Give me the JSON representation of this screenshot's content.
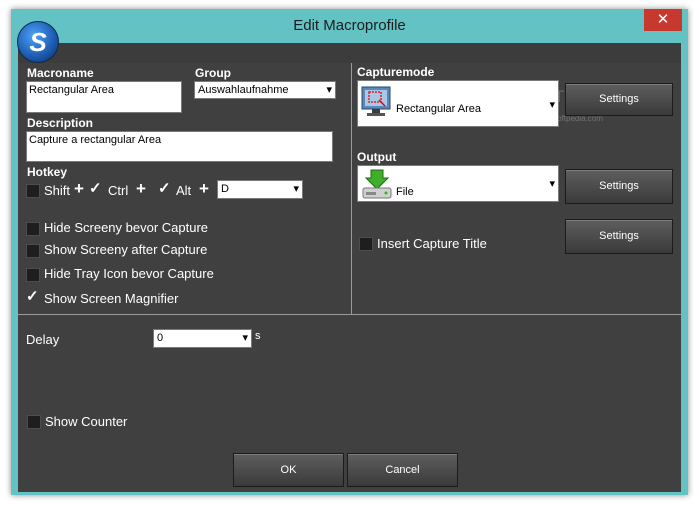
{
  "window": {
    "title": "Edit Macroprofile",
    "close_glyph": "✕",
    "logo_letter": "S"
  },
  "macro": {
    "macroname_label": "Macroname",
    "macroname_value": "Rectangular Area",
    "group_label": "Group",
    "group_value": "Auswahlaufnahme",
    "description_label": "Description",
    "description_value": "Capture a rectangular Area"
  },
  "hotkey": {
    "label": "Hotkey",
    "shift_label": "Shift",
    "shift_checked": false,
    "ctrl_label": "Ctrl",
    "ctrl_checked": true,
    "alt_label": "Alt",
    "alt_checked": true,
    "plus": "+",
    "key_value": "D"
  },
  "options": [
    {
      "label": "Hide Screeny bevor Capture",
      "checked": false
    },
    {
      "label": "Show Screeny after Capture",
      "checked": false
    },
    {
      "label": "Hide Tray Icon bevor Capture",
      "checked": false
    },
    {
      "label": "Show Screen Magnifier",
      "checked": true
    }
  ],
  "capturemode": {
    "label": "Capturemode",
    "value": "Rectangular Area",
    "icon": "monitor-selection-icon",
    "settings_label": "Settings"
  },
  "output": {
    "label": "Output",
    "value": "File",
    "icon": "save-to-disk-icon",
    "settings_label": "Settings"
  },
  "insert_title": {
    "label": "Insert Capture Title",
    "checked": false,
    "settings_label": "Settings"
  },
  "delay": {
    "label": "Delay",
    "value": "0",
    "unit": "s"
  },
  "show_counter": {
    "label": "Show Counter",
    "checked": false
  },
  "buttons": {
    "ok": "OK",
    "cancel": "Cancel"
  },
  "watermark": {
    "brand": "SOFTPEDIA",
    "url": "www.softpedia.com"
  },
  "colors": {
    "frame": "#63c3c4",
    "client_bg": "#2c2c2c",
    "panel_bg": "#404040",
    "close_red": "#c7392f",
    "text": "#ffffff"
  }
}
